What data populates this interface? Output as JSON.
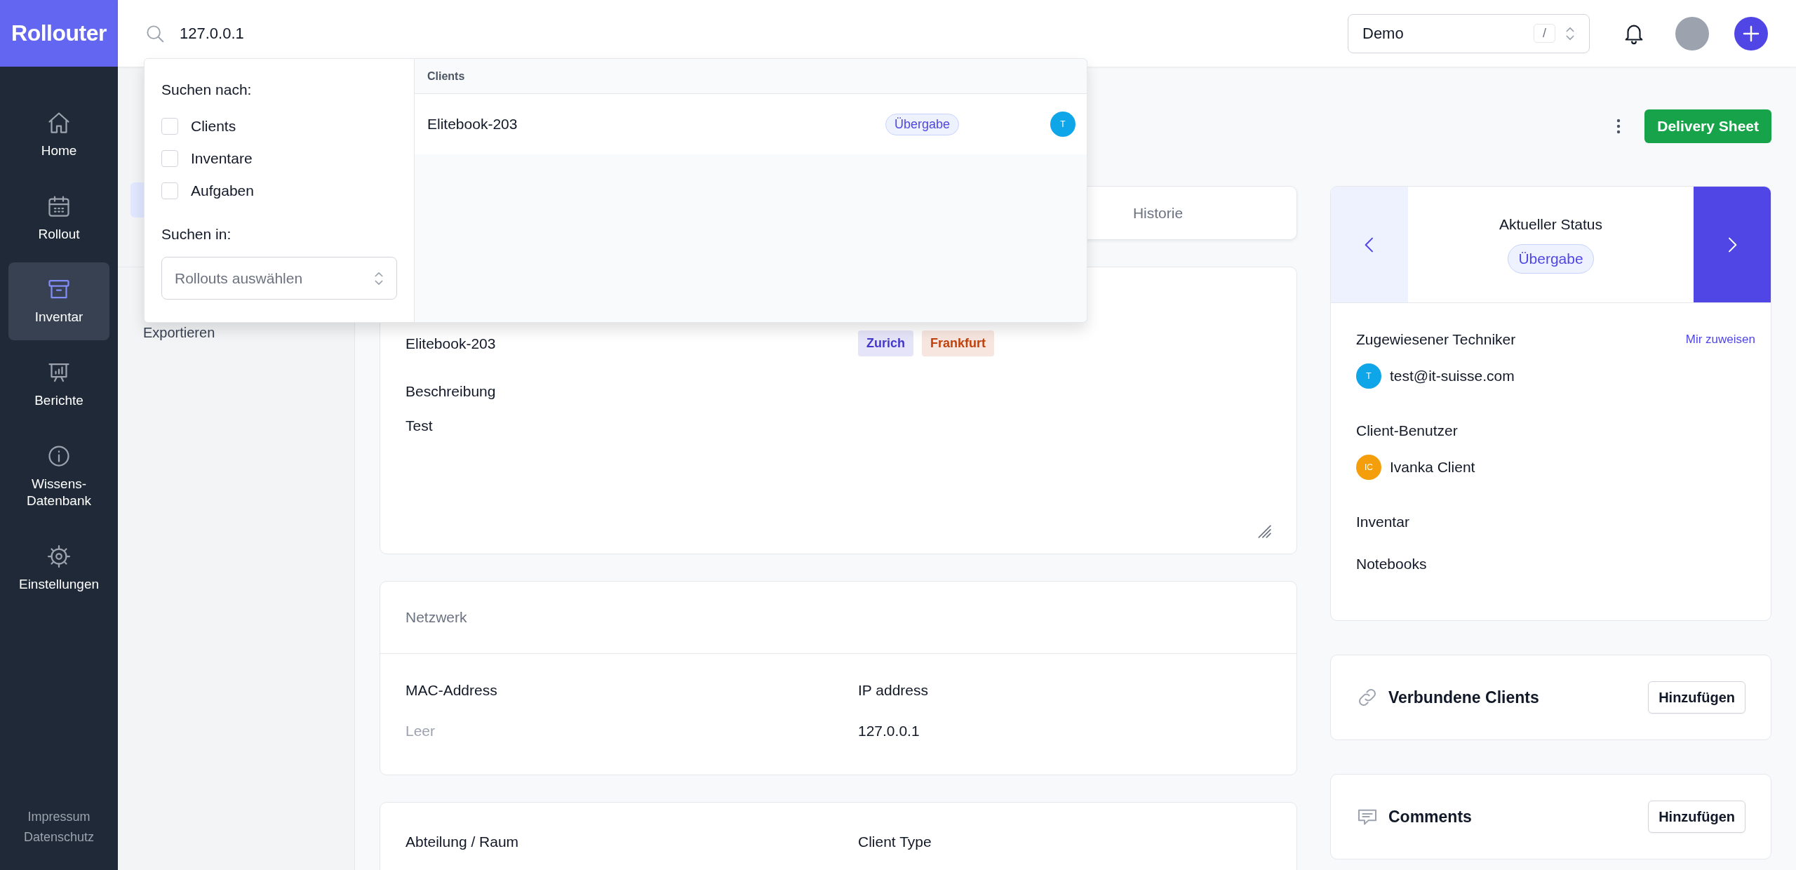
{
  "brand": {
    "name": "Rollouter"
  },
  "nav": [
    {
      "label": "Home",
      "selected": false
    },
    {
      "label": "Rollout",
      "selected": false
    },
    {
      "label": "Inventar",
      "selected": true
    },
    {
      "label": "Berichte",
      "selected": false
    },
    {
      "label": "Wissens-\nDatenbank",
      "selected": false
    },
    {
      "label": "Einstellungen",
      "selected": false
    }
  ],
  "footer_links": [
    "Impressum",
    "Datenschutz"
  ],
  "search": {
    "value": "127.0.0.1"
  },
  "workspace": {
    "value": "Demo",
    "shortcut": "/"
  },
  "search_popup": {
    "filter_title": "Suchen nach:",
    "filters": [
      {
        "label": "Clients",
        "checked": false
      },
      {
        "label": "Inventare",
        "checked": false
      },
      {
        "label": "Aufgaben",
        "checked": false
      }
    ],
    "scope_title": "Suchen in:",
    "scope": {
      "placeholder": "Rollouts auswählen"
    },
    "results": [
      {
        "group": "Clients",
        "items": [
          {
            "name": "Elitebook-203",
            "status": "Übergabe",
            "initials": "T",
            "color": "#0ea5e9"
          }
        ]
      }
    ]
  },
  "subnav": {
    "items": [
      {
        "label": "Exportieren"
      }
    ]
  },
  "header": {
    "primary_button": "Delivery Sheet"
  },
  "tabs": [
    {
      "label": "Historie",
      "selected": false
    }
  ],
  "general": {
    "name": "Elitebook-203",
    "tags": [
      {
        "label": "Zurich",
        "color": "#4338ca"
      },
      {
        "label": "Frankfurt",
        "color": "#c2410c"
      }
    ],
    "description_label": "Beschreibung",
    "description": "Test"
  },
  "network": {
    "title": "Netzwerk",
    "fields": [
      {
        "label": "MAC-Address",
        "value": "Leer",
        "empty": true
      },
      {
        "label": "IP address",
        "value": "127.0.0.1",
        "empty": false
      }
    ]
  },
  "location": {
    "fields": [
      {
        "label": "Abteilung / Raum"
      },
      {
        "label": "Client Type"
      }
    ]
  },
  "status": {
    "title": "Aktueller Status",
    "value": "Übergabe"
  },
  "assignment": {
    "technician_label": "Zugewiesener Techniker",
    "assign_link": "Mir zuweisen",
    "technician": {
      "initials": "T",
      "name": "test@it-suisse.com",
      "color": "#0ea5e9"
    },
    "client_user_label": "Client-Benutzer",
    "client_user": {
      "initials": "IC",
      "name": "Ivanka Client",
      "color": "#f59e0b"
    },
    "inventory_label": "Inventar",
    "inventory": "Notebooks"
  },
  "panels": [
    {
      "title": "Verbundene Clients",
      "button": "Hinzufügen"
    },
    {
      "title": "Comments",
      "button": "Hinzufügen"
    }
  ]
}
